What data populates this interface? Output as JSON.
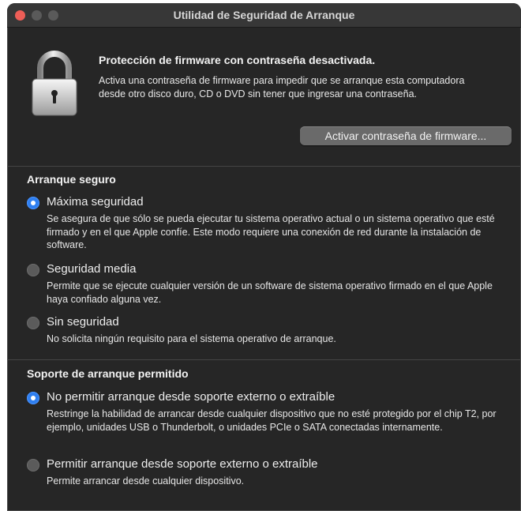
{
  "window": {
    "title": "Utilidad de Seguridad de Arranque"
  },
  "firmware": {
    "heading": "Protección de firmware con contraseña desactivada.",
    "description": "Activa una contraseña de firmware para impedir que se arranque esta computadora desde otro disco duro, CD o DVD sin tener que ingresar una contraseña.",
    "button_label": "Activar contraseña de firmware..."
  },
  "secure_boot": {
    "title": "Arranque seguro",
    "options": [
      {
        "label": "Máxima seguridad",
        "selected": true,
        "description": "Se asegura de que sólo se pueda ejecutar tu sistema operativo actual o un sistema operativo que esté firmado y en el que Apple confíe. Este modo requiere una conexión de red durante la instalación de software."
      },
      {
        "label": "Seguridad media",
        "selected": false,
        "description": "Permite que se ejecute cualquier versión de un software de sistema operativo firmado en el que Apple haya confiado alguna vez."
      },
      {
        "label": "Sin seguridad",
        "selected": false,
        "description": "No solicita ningún requisito para el sistema operativo de arranque."
      }
    ]
  },
  "external_boot": {
    "title": "Soporte de arranque permitido",
    "options": [
      {
        "label": "No permitir arranque desde soporte externo o extraíble",
        "selected": true,
        "description": "Restringe la habilidad de arrancar desde cualquier dispositivo que no esté protegido por el chip T2, por ejemplo, unidades USB o Thunderbolt, o unidades PCIe o SATA conectadas internamente."
      },
      {
        "label": "Permitir arranque desde soporte externo o extraíble",
        "selected": false,
        "description": "Permite arrancar desde cualquier dispositivo."
      }
    ]
  },
  "icons": {
    "window_close": "close-icon",
    "window_minimize": "minimize-icon",
    "window_zoom": "zoom-icon",
    "lock": "lock-icon"
  },
  "colors": {
    "accent": "#2f7ff0",
    "window_bg": "#262626",
    "close": "#ee5e57"
  }
}
